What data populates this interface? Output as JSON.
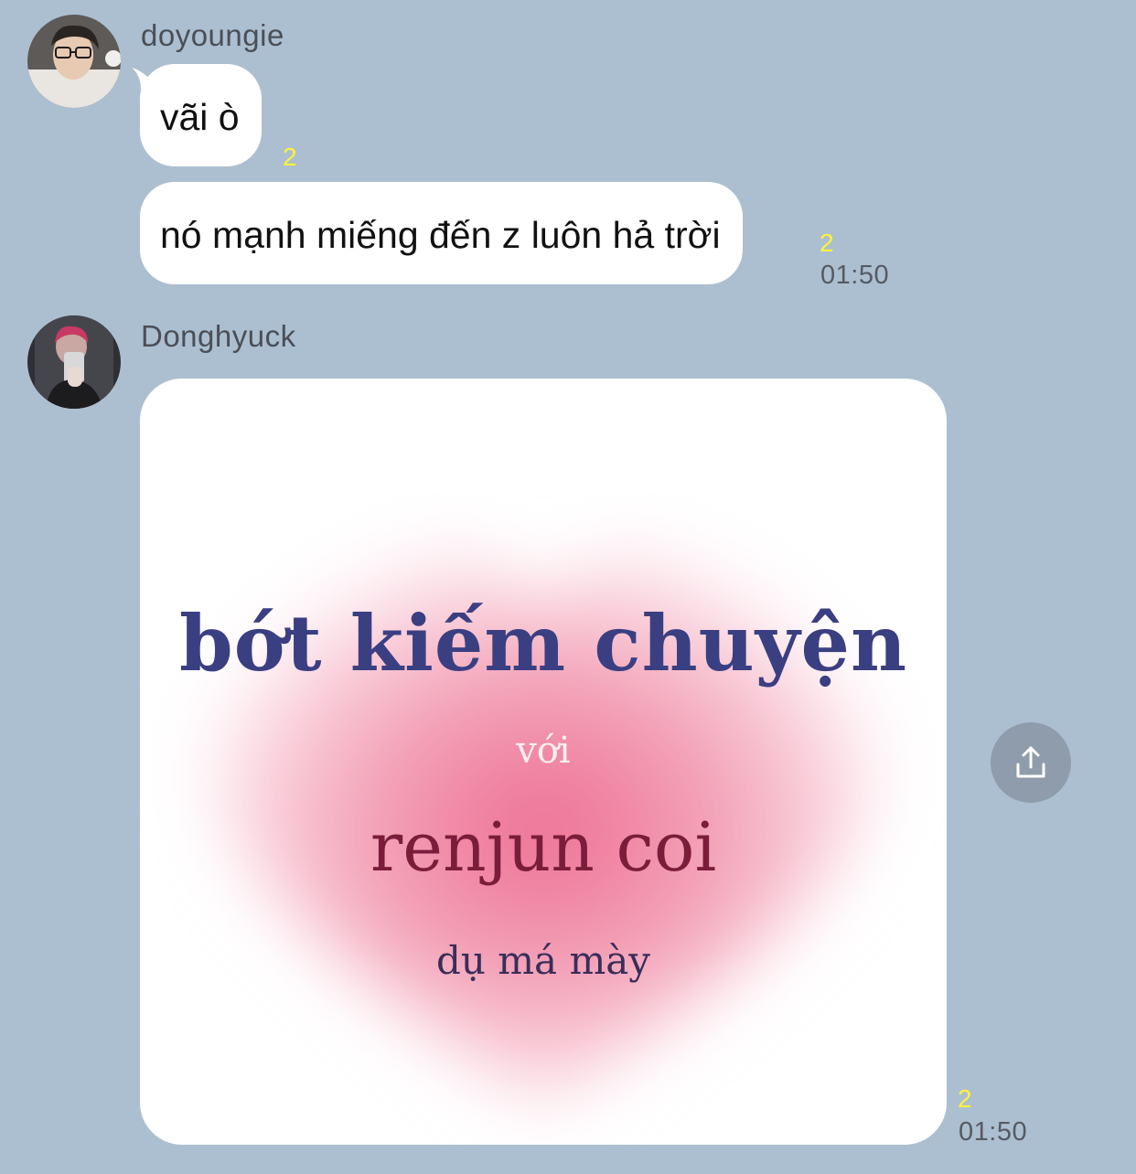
{
  "messages": [
    {
      "sender": "doyoungie",
      "avatar_icon": "user-avatar-photo",
      "bubbles": [
        {
          "text": "vãi ò",
          "read_count": "2"
        },
        {
          "text": "nó mạnh miếng đến z luôn hả trời",
          "read_count": "2",
          "time": "01:50"
        }
      ]
    },
    {
      "sender": "Donghyuck",
      "avatar_icon": "mirror-selfie-avatar-photo",
      "image": {
        "line1": "bớt kiếm chuyện",
        "line2": "với",
        "line3": "renjun coi",
        "line4": "dụ má mày"
      },
      "read_count": "2",
      "time": "01:50"
    }
  ],
  "share_button_icon": "share-icon",
  "colors": {
    "background": "#acbfd0",
    "bubble": "#ffffff",
    "read_count": "#fff23a",
    "heading_blue": "#3a3f82",
    "heading_red": "#7a1d3a",
    "share_button": "#8f9cab"
  }
}
